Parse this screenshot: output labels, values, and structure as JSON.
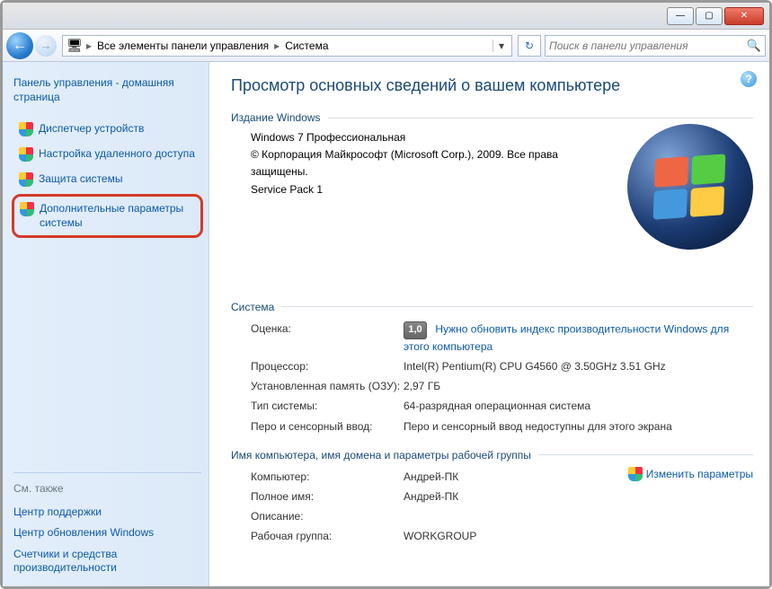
{
  "titlebar": {
    "min": "—",
    "max": "▢",
    "close": "✕"
  },
  "breadcrumb": {
    "root_icon": "🖥",
    "items": [
      "Все элементы панели управления",
      "Система"
    ]
  },
  "refresh_icon": "↻",
  "search": {
    "placeholder": "Поиск в панели управления",
    "icon": "🔍"
  },
  "help_icon": "?",
  "sidebar": {
    "home": "Панель управления - домашняя страница",
    "links": [
      "Диспетчер устройств",
      "Настройка удаленного доступа",
      "Защита системы",
      "Дополнительные параметры системы"
    ],
    "see_also_title": "См. также",
    "see_also": [
      "Центр поддержки",
      "Центр обновления Windows",
      "Счетчики и средства производительности"
    ]
  },
  "page_title": "Просмотр основных сведений о вашем компьютере",
  "edition": {
    "legend": "Издание Windows",
    "name": "Windows 7 Профессиональная",
    "copyright": "© Корпорация Майкрософт (Microsoft Corp.), 2009. Все права защищены.",
    "sp": "Service Pack 1"
  },
  "system": {
    "legend": "Система",
    "rows": {
      "rating_label": "Оценка:",
      "rating_score": "1,0",
      "rating_link": "Нужно обновить индекс производительности Windows для этого компьютера",
      "cpu_label": "Процессор:",
      "cpu_value": "Intel(R) Pentium(R) CPU G4560 @ 3.50GHz   3.51 GHz",
      "ram_label": "Установленная память (ОЗУ):",
      "ram_value": "2,97 ГБ",
      "type_label": "Тип системы:",
      "type_value": "64-разрядная операционная система",
      "pen_label": "Перо и сенсорный ввод:",
      "pen_value": "Перо и сенсорный ввод недоступны для этого экрана"
    }
  },
  "idgroup": {
    "legend": "Имя компьютера, имя домена и параметры рабочей группы",
    "change_link": "Изменить параметры",
    "rows": {
      "computer_label": "Компьютер:",
      "computer_value": "Андрей-ПК",
      "full_label": "Полное имя:",
      "full_value": "Андрей-ПК",
      "desc_label": "Описание:",
      "desc_value": "",
      "wg_label": "Рабочая группа:",
      "wg_value": "WORKGROUP"
    }
  }
}
